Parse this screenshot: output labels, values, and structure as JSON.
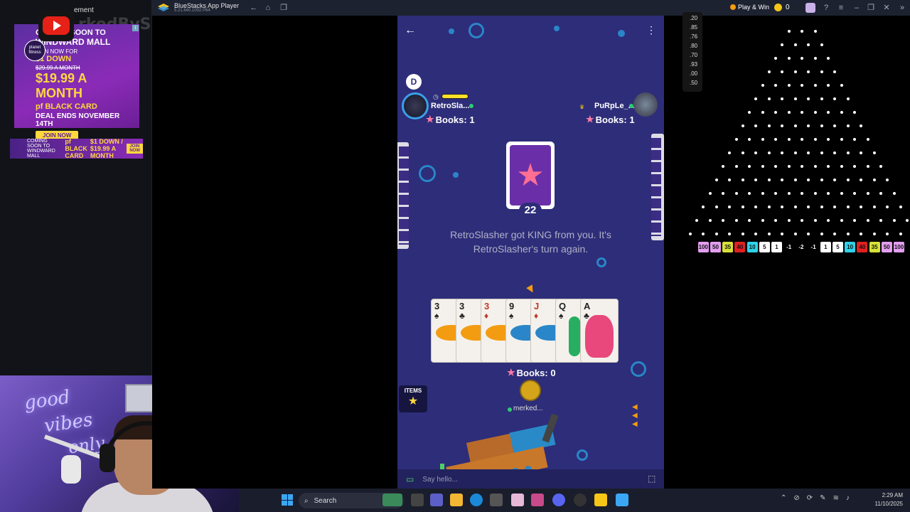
{
  "stream": {
    "ad_label": "ement",
    "watermark": "rkedBySnow",
    "ad_big": {
      "logo": "planet fitness",
      "line1": "COMING SOON TO",
      "line2": "WINDWARD MALL",
      "line3": "JOIN NOW FOR",
      "line4": "$1 DOWN",
      "strike": "$29.99 A MONTH",
      "price": "$19.99 A MONTH",
      "card": "pf BLACK CARD",
      "deal": "DEAL ENDS NOVEMBER 14TH",
      "join": "JOIN NOW"
    },
    "ad_small": {
      "left": "COMING SOON TO WINDWARD MALL",
      "mid": "pf BLACK CARD",
      "price": "$1 DOWN / $19.99 A MONTH",
      "join": "JOIN NOW"
    },
    "webcam_neon": [
      "good",
      "vibes",
      "only"
    ]
  },
  "bluestacks": {
    "title": "BlueStacks App Player",
    "version": "5.21.640.1002  P64",
    "play_win": "Play & Win",
    "coins": "0"
  },
  "game": {
    "dealer_badge": "D",
    "player1": {
      "name": "RetroSla...",
      "books": "Books: 1"
    },
    "player2": {
      "name": "PuRpLe_...",
      "books": "Books: 1"
    },
    "deck_count": "22",
    "message": "RetroSlasher got KING from you. It's RetroSlasher's turn again.",
    "hand": [
      {
        "rank": "3",
        "suit": "♠",
        "red": false,
        "art": "fish"
      },
      {
        "rank": "3",
        "suit": "♣",
        "red": false,
        "art": "fish"
      },
      {
        "rank": "3",
        "suit": "♦",
        "red": true,
        "art": "fish"
      },
      {
        "rank": "9",
        "suit": "♠",
        "red": false,
        "art": "blue"
      },
      {
        "rank": "J",
        "suit": "♦",
        "red": true,
        "art": "blue"
      },
      {
        "rank": "Q",
        "suit": "♠",
        "red": false,
        "art": "green"
      },
      {
        "rank": "A",
        "suit": "♣",
        "red": false,
        "art": "pink"
      }
    ],
    "my_books": "Books: 0",
    "my_name": "merked...",
    "items_label": "ITEMS",
    "chat_placeholder": "Say hello..."
  },
  "plinko": {
    "multipliers": [
      ".20",
      ".85",
      ".76",
      ".80",
      ".70",
      ".93",
      ".00",
      ".50"
    ],
    "buckets": [
      "100",
      "50",
      "35",
      "40",
      "10",
      "5",
      "1",
      "-1",
      "-2",
      "-1",
      "1",
      "5",
      "10",
      "40",
      "35",
      "50",
      "100"
    ],
    "bucket_colors": [
      "#e39ef0",
      "#e39ef0",
      "#d6e23a",
      "#e02020",
      "#2fd2e8",
      "#ffffff",
      "#ffffff",
      "",
      "",
      "",
      "#ffffff",
      "#ffffff",
      "#2fd2e8",
      "#e02020",
      "#d6e23a",
      "#e39ef0",
      "#e39ef0"
    ]
  },
  "taskbar": {
    "search_label": "Search",
    "time": "2:29 AM",
    "date": "11/10/2025"
  }
}
